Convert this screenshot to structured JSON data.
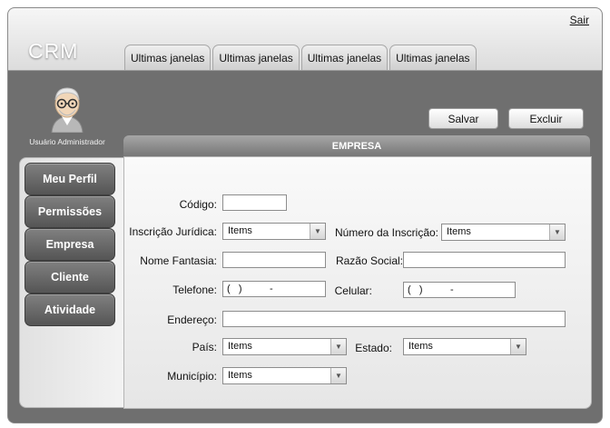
{
  "header": {
    "brand": "CRM",
    "logout_label": "Sair",
    "tabs": [
      {
        "label": "Ultimas janelas"
      },
      {
        "label": "Ultimas janelas"
      },
      {
        "label": "Ultimas janelas"
      },
      {
        "label": "Ultimas janelas"
      }
    ]
  },
  "user": {
    "name": "Usuário Administrador"
  },
  "actions": {
    "save_label": "Salvar",
    "delete_label": "Excluir"
  },
  "section": {
    "title": "EMPRESA"
  },
  "sidebar": {
    "items": [
      {
        "label": "Meu Perfil"
      },
      {
        "label": "Permissões"
      },
      {
        "label": "Empresa"
      },
      {
        "label": "Cliente"
      },
      {
        "label": "Atividade"
      }
    ]
  },
  "form": {
    "codigo": {
      "label": "Código:",
      "value": ""
    },
    "inscricao_juridica": {
      "label": "Inscrição Jurídica:",
      "value": "Items"
    },
    "numero_inscricao": {
      "label": "Número da Inscrição:",
      "value": "Items"
    },
    "nome_fantasia": {
      "label": "Nome Fantasia:",
      "value": ""
    },
    "razao_social": {
      "label": "Razão Social:",
      "value": ""
    },
    "telefone": {
      "label": "Telefone:",
      "value": "(   )          -"
    },
    "celular": {
      "label": "Celular:",
      "value": "(   )          -"
    },
    "endereco": {
      "label": "Endereço:",
      "value": ""
    },
    "pais": {
      "label": "País:",
      "value": "Items"
    },
    "estado": {
      "label": "Estado:",
      "value": "Items"
    },
    "municipio": {
      "label": "Município:",
      "value": "Items"
    }
  },
  "icons": {
    "avatar": "user-avatar-icon",
    "dropdown": "chevron-down-icon"
  }
}
